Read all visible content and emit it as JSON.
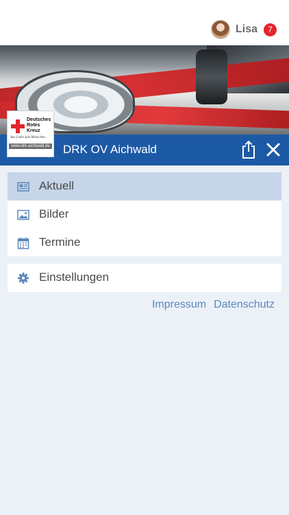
{
  "user": {
    "name": "Lisa",
    "badge_count": "7"
  },
  "header": {
    "title": "DRK OV Aichwald"
  },
  "logo": {
    "lines": [
      "Deutsches",
      "Rotes",
      "Kreuz"
    ],
    "slogan": "Aus Liebe zum Menschen.",
    "url": "www.drk-aichwald.de"
  },
  "menu": {
    "items": [
      {
        "label": "Aktuell",
        "icon": "newspaper-icon",
        "active": true
      },
      {
        "label": "Bilder",
        "icon": "image-icon",
        "active": false
      },
      {
        "label": "Termine",
        "icon": "calendar-icon",
        "active": false
      }
    ],
    "settings": {
      "label": "Einstellungen",
      "icon": "gear-icon"
    }
  },
  "footer": {
    "impressum": "Impressum",
    "datenschutz": "Datenschutz"
  },
  "colors": {
    "header_blue": "#1d5aa6",
    "active_item": "#c6d5e8",
    "icon_blue": "#5b87b8",
    "badge_red": "#e2262c",
    "background": "#ecf1f8"
  }
}
